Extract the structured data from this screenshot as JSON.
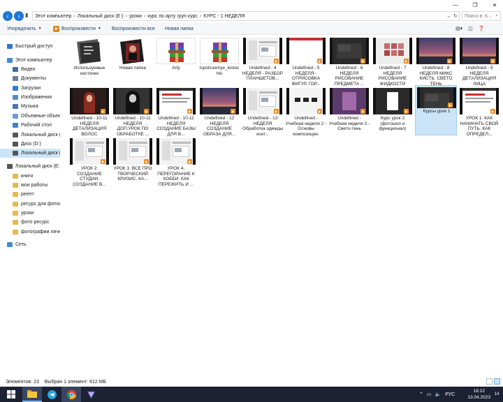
{
  "window": {
    "controls": [
      "—",
      "❐",
      "✕"
    ]
  },
  "address": {
    "crumbs": [
      "Этот компьютер",
      "Локальный диск (E:)",
      "уроки",
      "курс по арту груп курс",
      "КУРС - 1 НЕДЕЛЯ"
    ],
    "separator": "›",
    "search_placeholder": "Поиск в: К..."
  },
  "toolbar": {
    "organize": "Упорядочить",
    "play": "Воспроизвести",
    "play_all": "Воспроизвести все",
    "new_folder": "Новая папка"
  },
  "sidebar": {
    "items": [
      {
        "label": "Быстрый доступ",
        "icon": "star-icon",
        "color": "#2b79d0"
      },
      {
        "label": "Этот компьютер",
        "icon": "computer-icon",
        "color": "#3c8fd8"
      },
      {
        "label": "Видео",
        "icon": "video-folder-icon",
        "color": "#3d6fa8"
      },
      {
        "label": "Документы",
        "icon": "documents-folder-icon",
        "color": "#6b7f99"
      },
      {
        "label": "Загрузки",
        "icon": "downloads-folder-icon",
        "color": "#2f7fd1"
      },
      {
        "label": "Изображения",
        "icon": "pictures-folder-icon",
        "color": "#5a8fc2"
      },
      {
        "label": "Музыка",
        "icon": "music-folder-icon",
        "color": "#4a74b2"
      },
      {
        "label": "Объемные объекты",
        "icon": "3d-objects-icon",
        "color": "#6a9bd6"
      },
      {
        "label": "Рабочий стол",
        "icon": "desktop-folder-icon",
        "color": "#3b82d4"
      },
      {
        "label": "Локальный диск (C:)",
        "icon": "drive-icon",
        "color": "#555555"
      },
      {
        "label": "Диск (D:)",
        "icon": "drive-icon",
        "color": "#555555"
      },
      {
        "label": "Локальный диск (E:)",
        "icon": "drive-icon",
        "color": "#555555"
      },
      {
        "label": "Локальный диск (E:)",
        "icon": "drive-icon",
        "color": "#555555"
      },
      {
        "label": "книги",
        "icon": "folder-icon",
        "color": "#e8b84a"
      },
      {
        "label": "мои работы",
        "icon": "folder-icon",
        "color": "#e8b84a"
      },
      {
        "label": "реепт",
        "icon": "folder-icon",
        "color": "#e8b84a"
      },
      {
        "label": "ресурс для фотошопа",
        "icon": "folder-icon",
        "color": "#e8b84a"
      },
      {
        "label": "уроки",
        "icon": "folder-icon",
        "color": "#e8b84a"
      },
      {
        "label": "фото ресурс",
        "icon": "folder-icon",
        "color": "#e8b84a"
      },
      {
        "label": "фотографии личные",
        "icon": "folder-icon",
        "color": "#e8b84a"
      },
      {
        "label": "Сеть",
        "icon": "network-icon",
        "color": "#3c8fd8"
      }
    ]
  },
  "files": [
    {
      "label": "Используемые кисточки",
      "kind": "folder-dark"
    },
    {
      "label": "Новая папка",
      "kind": "folder-photo"
    },
    {
      "label": "Arty",
      "kind": "rar"
    },
    {
      "label": "Ispolzuemye_kistochki",
      "kind": "rar"
    },
    {
      "label": "Undefined - 4 НЕДЕЛЯ - РАЗБОР ПЛАНШЕТОВ...",
      "kind": "video",
      "frame": "light"
    },
    {
      "label": "Undefined - 5 НЕДЕЛЯ - ОТРИСОВКА ФИГУР, ГОР...",
      "kind": "video",
      "frame": "white"
    },
    {
      "label": "Undefined - 6 НЕДЕЛЯ РИСОВАНИЕ ПРЕДМЕТА ...",
      "kind": "video",
      "frame": "dark"
    },
    {
      "label": "Undefined - 7 НЕДЕЛЯ РИСОВАНИЕ ЖИДКОСТИ",
      "kind": "video",
      "frame": "grid"
    },
    {
      "label": "Undefined - 8 НЕДЕЛЯ МИКС КИСТЬ. СВЕТО ТЕНЬ",
      "kind": "video",
      "frame": "sunset"
    },
    {
      "label": "Undefined - 9 НЕДЕЛЯ ДЕТАЛИЗАЦИЯ ЛИЦА",
      "kind": "video",
      "frame": "sunset"
    },
    {
      "label": "Undefined - 10-11 НЕДЕЛЯ ДЕТАЛИЗАЦИЯ ВОЛОС",
      "kind": "video",
      "frame": "portrait-red"
    },
    {
      "label": "Undefined - 10-11 НЕДЕЛЯ ДОП.УРОК ПО ОБРАБОТКЕ ...",
      "kind": "video",
      "frame": "portrait-bw"
    },
    {
      "label": "Undefined - 10-11 НЕДЕЛЯ СОЗДАНИЕ БАЗЫ ДЛЯ В...",
      "kind": "video",
      "frame": "web-red"
    },
    {
      "label": "Undefined - 12 НЕДЕЛЯ СОЗДАНИЕ ОБРАЗА ДЛЯ...",
      "kind": "video",
      "frame": "sunset"
    },
    {
      "label": "Undefined - 13 НЕДЕЛЯ Обработка одежды конт...",
      "kind": "video",
      "frame": "light"
    },
    {
      "label": "Undefined - Учебная неделя 2 - Основы композиции.",
      "kind": "video",
      "frame": "shapes"
    },
    {
      "label": "Undefined - Учебная неделя 3 - Свето-тень",
      "kind": "video",
      "frame": "purple"
    },
    {
      "label": "Курс урок 2 (фотошоп и функционал)",
      "kind": "video",
      "frame": "center-white"
    },
    {
      "label": "Курсы урок 1",
      "kind": "video",
      "frame": "dark",
      "selected": true
    },
    {
      "label": "УРОК 1. КАК НАЧИНАТЬ СВОЙ ПУТЬ, КАК ОПРЕДЕЛ...",
      "kind": "video",
      "frame": "web-red"
    },
    {
      "label": "УРОК 2. СОЗДАНИЕ СТУДИИ, СОЗДАНИЕ В...",
      "kind": "video",
      "frame": "light"
    },
    {
      "label": "УРОК 3. ВСЕ ПРО ТВОРЧЕСКИЙ КРИЗИС. КА...",
      "kind": "video",
      "frame": "light"
    },
    {
      "label": "УРОК 4. ПЕРЕГОРАНИЕ К ХОББИ. КАК ПЕРЕЖИТЬ И ...",
      "kind": "video",
      "frame": "light"
    }
  ],
  "status": {
    "count": "Элементов: 23",
    "selected": "Выбран 1 элемент: 612 МБ"
  },
  "taskbar": {
    "lang": "РУС",
    "time": "18:12",
    "date": "13.04.2023",
    "notifications": "14"
  }
}
